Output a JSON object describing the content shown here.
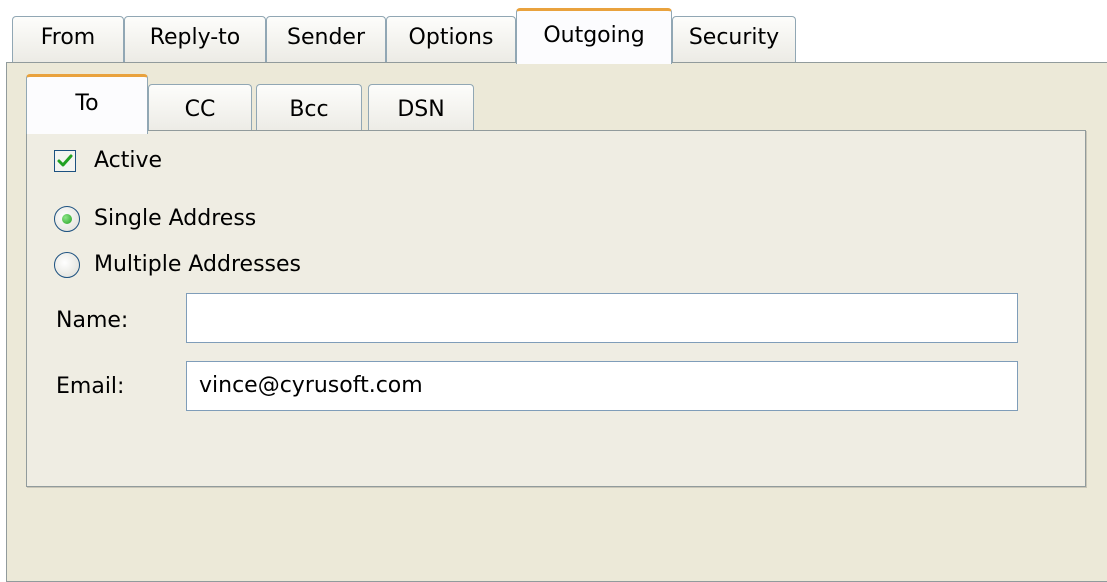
{
  "outer_tabs": {
    "items": [
      "From",
      "Reply-to",
      "Sender",
      "Options",
      "Outgoing",
      "Security"
    ],
    "active": "Outgoing"
  },
  "inner_tabs": {
    "items": [
      "To",
      "CC",
      "Bcc",
      "DSN"
    ],
    "active": "To"
  },
  "active_checkbox": {
    "label": "Active",
    "checked": true
  },
  "address_mode": {
    "options": [
      "Single Address",
      "Multiple Addresses"
    ],
    "selected": "Single Address"
  },
  "fields": {
    "name": {
      "label": "Name:",
      "value": ""
    },
    "email": {
      "label": "Email:",
      "value": "vince@cyrusoft.com"
    }
  },
  "colors": {
    "panel_bg": "#ece9d8",
    "active_tab_accent": "#e9a23d",
    "check_green": "#21a121",
    "field_border": "#7f9db9"
  }
}
